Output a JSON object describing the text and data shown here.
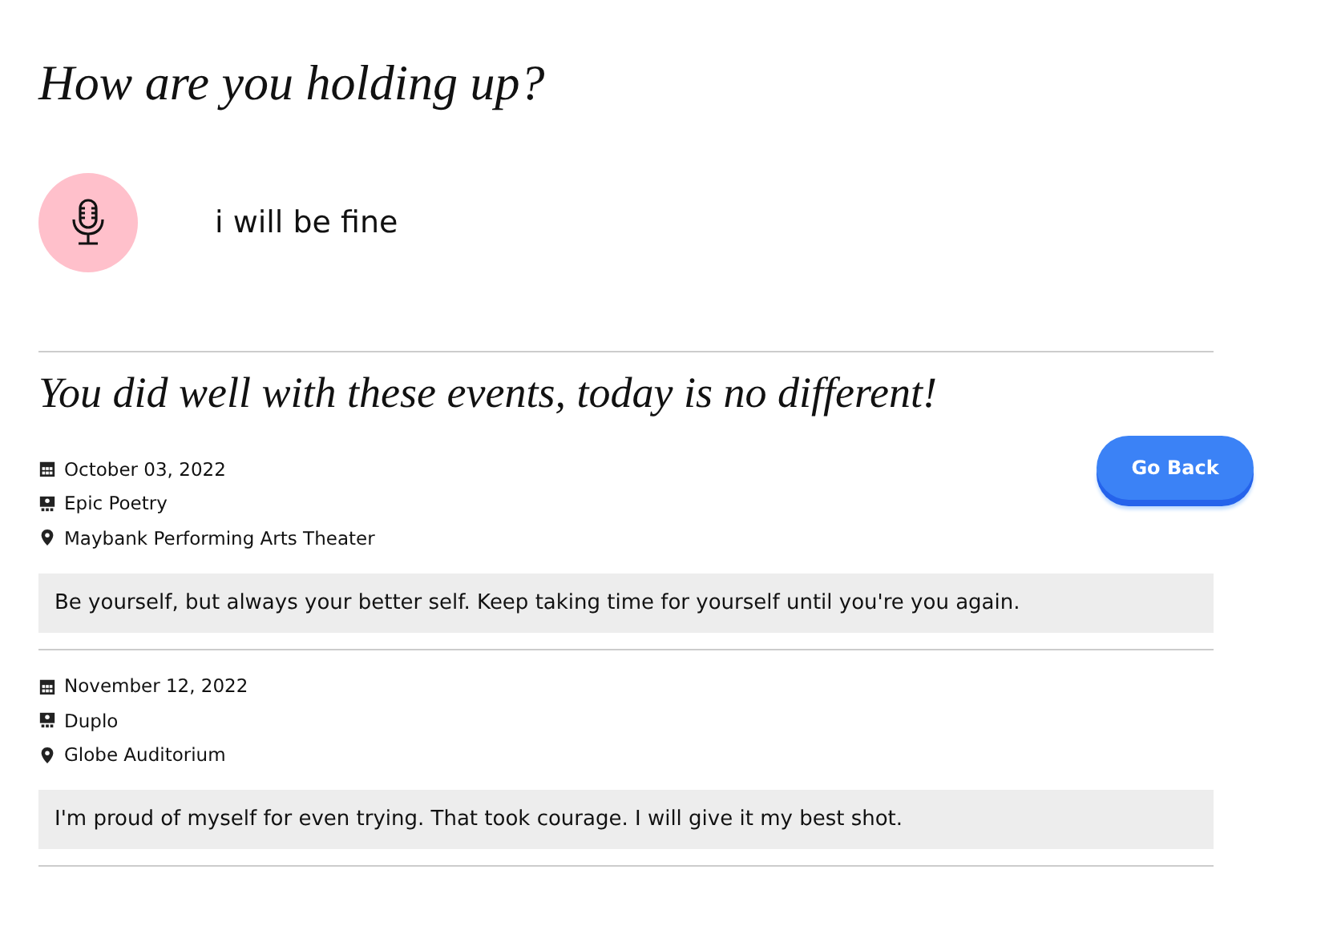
{
  "title": "How are you holding up?",
  "answer": {
    "text": "i will be fine"
  },
  "subtitle": "You did well with these events, today is no different!",
  "back_button": "Go Back",
  "events": [
    {
      "date": "October 03, 2022",
      "name": "Epic Poetry",
      "venue": "Maybank Performing Arts Theater",
      "note": "Be yourself, but always your better self. Keep taking time for yourself until you're you again."
    },
    {
      "date": "November 12, 2022",
      "name": "Duplo",
      "venue": "Globe Auditorium",
      "note": "I'm proud of myself for even trying. That took courage. I will give it my best shot."
    }
  ]
}
